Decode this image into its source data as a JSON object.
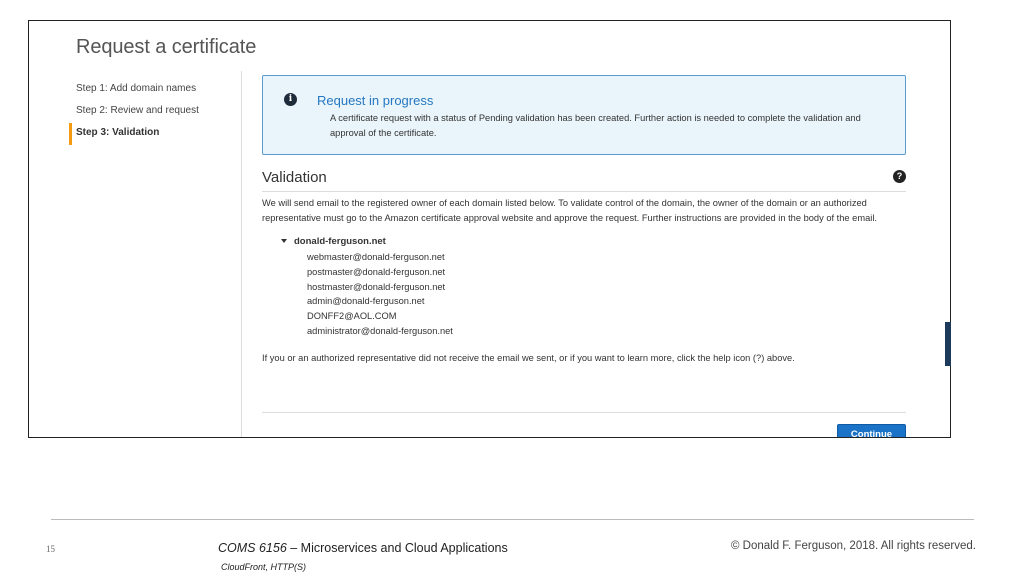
{
  "page": {
    "title": "Request a certificate"
  },
  "steps": [
    {
      "label": "Step 1: Add domain names",
      "active": false
    },
    {
      "label": "Step 2: Review and request",
      "active": false
    },
    {
      "label": "Step 3: Validation",
      "active": true
    }
  ],
  "alert": {
    "icon": "info-icon",
    "title": "Request in progress",
    "body": "A certificate request with a status of Pending validation has been created. Further action is needed to complete the validation and approval of the certificate."
  },
  "validation": {
    "title": "Validation",
    "help_icon": "help-icon",
    "description": "We will send email to the registered owner of each domain listed below. To validate control of the domain, the owner of the domain or an authorized representative must go to the Amazon certificate approval website and approve the request. Further instructions are provided in the body of the email.",
    "domain": "donald-ferguson.net",
    "emails": [
      "webmaster@donald-ferguson.net",
      "postmaster@donald-ferguson.net",
      "hostmaster@donald-ferguson.net",
      "admin@donald-ferguson.net",
      "DONFF2@AOL.COM",
      "administrator@donald-ferguson.net"
    ],
    "footnote": "If you or an authorized representative did not receive the email we sent, or if you want to learn more, click the help icon (?) above."
  },
  "actions": {
    "continue_label": "Continue",
    "button_color": "#1a73c7"
  },
  "slide": {
    "number": "15",
    "course_code": "COMS 6156",
    "course_rest": " – Microservices and Cloud Applications",
    "subtitle": "CloudFront, HTTP(S)",
    "copyright": "© Donald F. Ferguson, 2018. All rights reserved."
  },
  "colors": {
    "accent": "#f39c12",
    "alert_title": "#2577c2",
    "alert_border": "#5a9bcf",
    "alert_bg": "#eaf5fb"
  }
}
